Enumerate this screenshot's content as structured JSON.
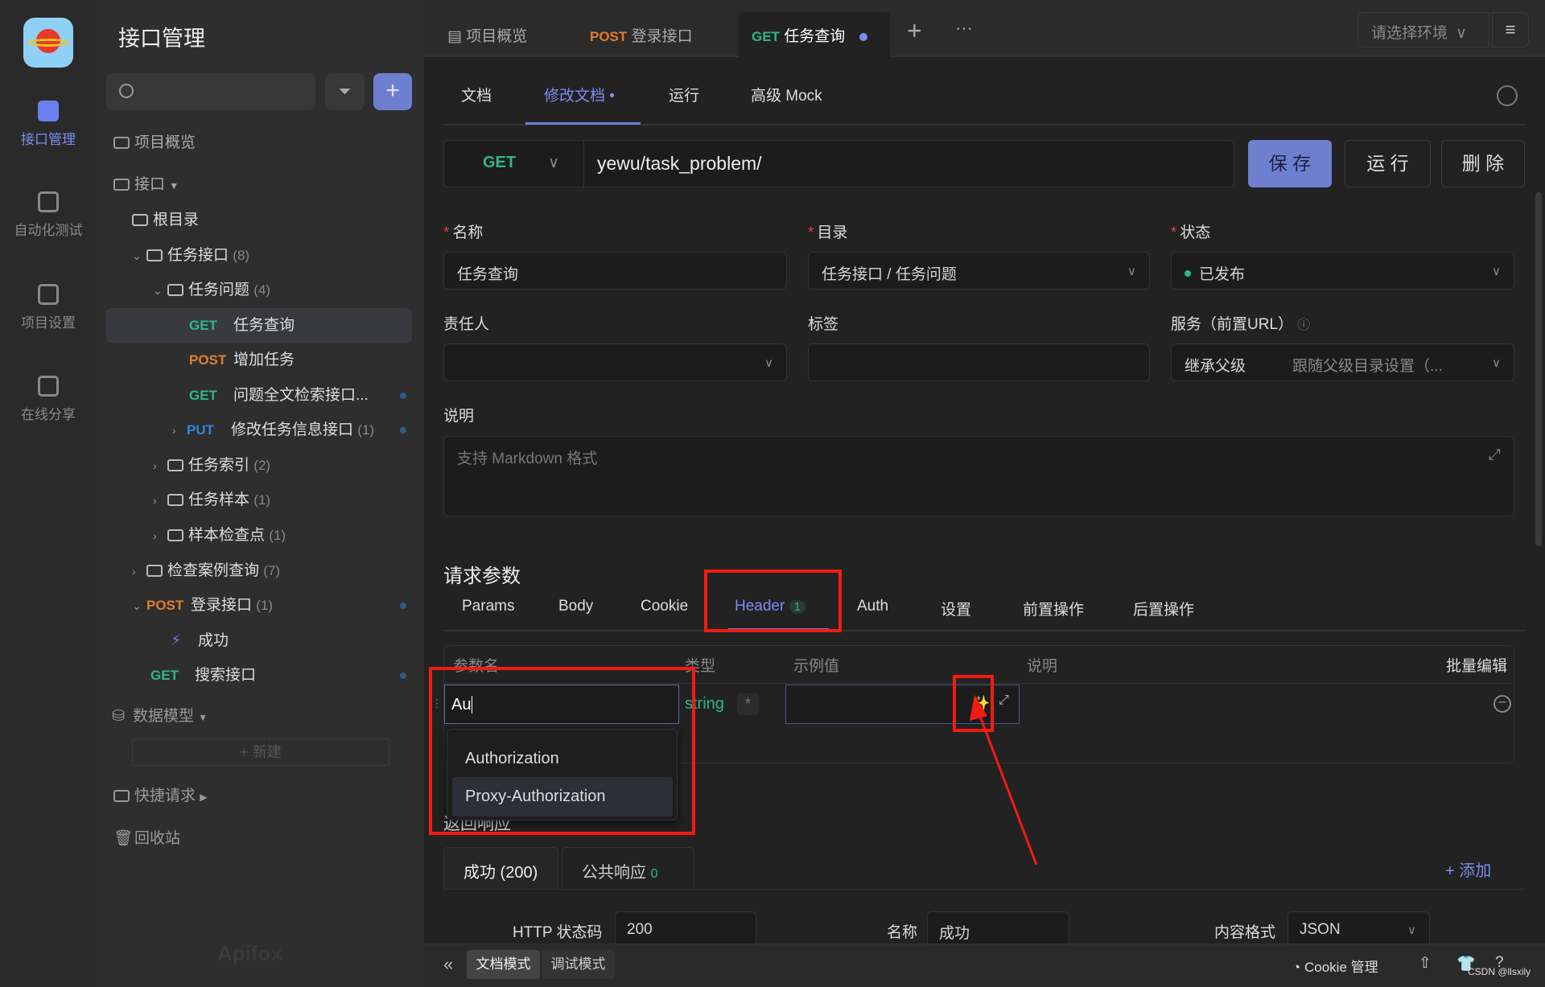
{
  "rail": {
    "items": [
      {
        "label": "接口管理",
        "icon": "api-icon",
        "active": true
      },
      {
        "label": "自动化测试",
        "icon": "automation-icon"
      },
      {
        "label": "项目设置",
        "icon": "settings-icon"
      },
      {
        "label": "在线分享",
        "icon": "share-icon"
      }
    ]
  },
  "sidebar": {
    "title": "接口管理",
    "search_placeholder": "",
    "overview": "项目概览",
    "api": "接口",
    "root": "根目录",
    "tree": [
      {
        "type": "folder",
        "label": "任务接口",
        "count": "(8)"
      },
      {
        "type": "folder",
        "label": "任务问题",
        "count": "(4)"
      },
      {
        "method": "GET",
        "label": "任务查询",
        "selected": true
      },
      {
        "method": "POST",
        "label": "增加任务"
      },
      {
        "method": "GET",
        "label": "问题全文检索接口..."
      },
      {
        "method": "PUT",
        "label": "修改任务信息接口",
        "count": "(1)"
      },
      {
        "type": "folder",
        "label": "任务索引",
        "count": "(2)"
      },
      {
        "type": "folder",
        "label": "任务样本",
        "count": "(1)"
      },
      {
        "type": "folder",
        "label": "样本检查点",
        "count": "(1)"
      },
      {
        "type": "folder",
        "label": "检查案例查询",
        "count": "(7)"
      },
      {
        "method": "POST",
        "label": "登录接口",
        "count": "(1)"
      },
      {
        "type": "case",
        "label": "成功"
      },
      {
        "method": "GET",
        "label": "搜索接口"
      }
    ],
    "data_model": "数据模型",
    "new": "+ 新建",
    "quick_request": "快捷请求",
    "recycle": "回收站",
    "watermark": "Apifox"
  },
  "tabs": {
    "items": [
      {
        "label": "项目概览"
      },
      {
        "method": "POST",
        "label": "登录接口"
      },
      {
        "method": "GET",
        "label": "任务查询",
        "active": true
      }
    ],
    "env": "请选择环境"
  },
  "subtabs": [
    "文档",
    "修改文档",
    "运行",
    "高级 Mock"
  ],
  "url": {
    "method": "GET",
    "path": "yewu/task_problem/",
    "save": "保 存",
    "run": "运 行",
    "delete": "删 除"
  },
  "form": {
    "name_label": "名称",
    "name": "任务查询",
    "dir_label": "目录",
    "dir": "任务接口 / 任务问题",
    "status_label": "状态",
    "status": "已发布",
    "status_color": "#2fb58c",
    "owner_label": "责任人",
    "tags_label": "标签",
    "service_label": "服务（前置URL）",
    "service_value": "继承父级",
    "service_hint": "跟随父级目录设置（...",
    "desc_label": "说明",
    "desc_placeholder": "支持 Markdown 格式"
  },
  "params": {
    "title": "请求参数",
    "tabs": [
      "Params",
      "Body",
      "Cookie",
      "Header",
      "Auth",
      "设置",
      "前置操作",
      "后置操作"
    ],
    "header_count": "1",
    "columns": [
      "参数名",
      "类型",
      "示例值",
      "说明"
    ],
    "bulk_edit": "批量编辑",
    "row": {
      "name": "Au",
      "type": "string",
      "required": "*"
    },
    "suggestions": [
      "Authorization",
      "Proxy-Authorization"
    ]
  },
  "response": {
    "title": "返回响应",
    "tabs": [
      {
        "label": "成功 (200)"
      },
      {
        "label": "公共响应",
        "count": "0"
      }
    ],
    "add": "+ 添加",
    "status_label": "HTTP 状态码",
    "status": "200",
    "name_label": "名称",
    "name": "成功",
    "format_label": "内容格式",
    "format": "JSON"
  },
  "bottom": {
    "doc_mode": "文档模式",
    "debug_mode": "调试模式",
    "cookie": "Cookie 管理",
    "watermark": "CSDN @llsxily"
  },
  "colors": {
    "accent": "#6f7fcf",
    "get": "#2fb58c",
    "post": "#e07e2c",
    "put": "#2f86e0",
    "annotation": "#f21b12"
  }
}
